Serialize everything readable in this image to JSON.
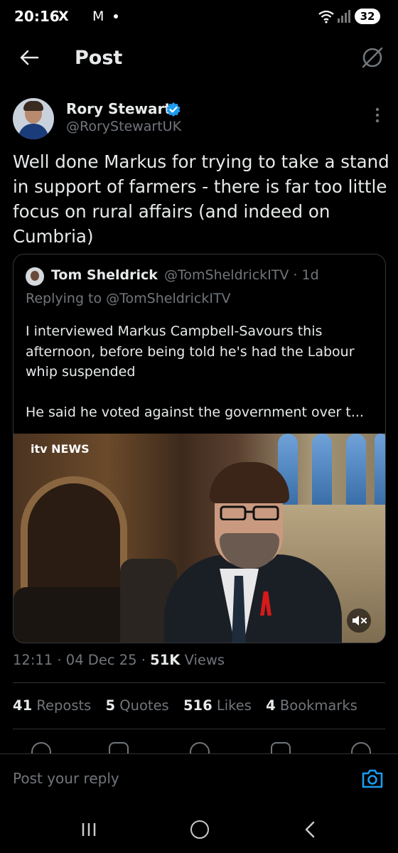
{
  "status_bar": {
    "time": "20:16",
    "x_icon": "X",
    "mail_icon": "M",
    "battery": "32"
  },
  "header": {
    "title": "Post"
  },
  "post": {
    "author_name": "Rory Stewart",
    "author_handle": "@RoryStewartUK",
    "text": "Well done Markus for trying to take a stand in support of farmers - there is far too little focus on rural affairs (and indeed on Cumbria)",
    "timestamp": "12:11 · 04 Dec 25 · ",
    "views_count": "51K",
    "views_label": " Views"
  },
  "quote": {
    "author_name": "Tom Sheldrick",
    "author_handle": "@TomSheldrickITV · 1d",
    "replying_to": "Replying to @TomSheldrickITV",
    "text": "I interviewed Markus Campbell-Savours this afternoon, before being told he's had the Labour whip suspended\n\nHe said he voted against the government over t...",
    "media_logo": "itv NEWS"
  },
  "stats": [
    {
      "count": "41",
      "label": "Reposts"
    },
    {
      "count": "5",
      "label": "Quotes"
    },
    {
      "count": "516",
      "label": "Likes"
    },
    {
      "count": "4",
      "label": "Bookmarks"
    }
  ],
  "reply": {
    "placeholder": "Post your reply"
  },
  "colors": {
    "background": "#000000",
    "text": "#e7e9ea",
    "muted": "#71767b",
    "accent": "#1d9bf0",
    "border": "#2f3336"
  },
  "icons": [
    "back-arrow-icon",
    "grok-icon",
    "verified-badge-icon",
    "more-vertical-icon",
    "mute-icon",
    "camera-icon",
    "wifi-icon",
    "signal-icon",
    "youtube-icon"
  ]
}
